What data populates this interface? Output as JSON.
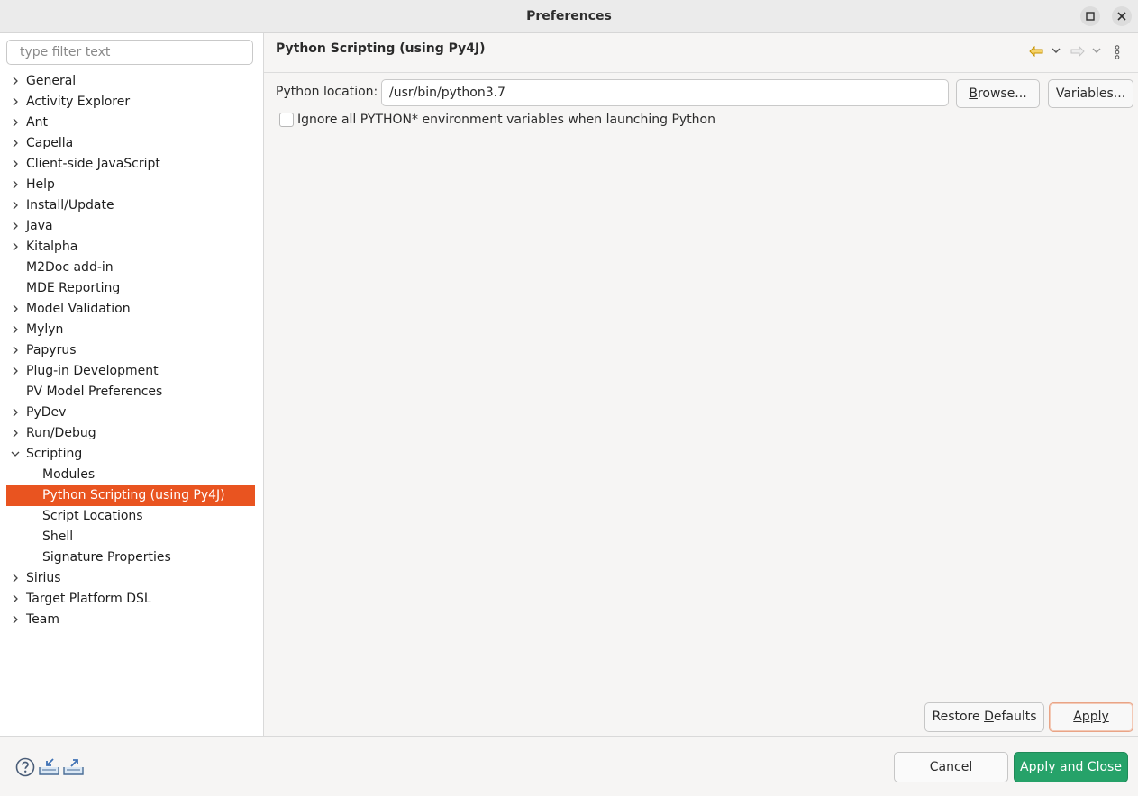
{
  "window": {
    "title": "Preferences"
  },
  "filter": {
    "placeholder": "type filter text"
  },
  "tree": {
    "items": [
      {
        "label": "General",
        "expandable": true
      },
      {
        "label": "Activity Explorer",
        "expandable": true
      },
      {
        "label": "Ant",
        "expandable": true
      },
      {
        "label": "Capella",
        "expandable": true
      },
      {
        "label": "Client-side JavaScript",
        "expandable": true
      },
      {
        "label": "Help",
        "expandable": true
      },
      {
        "label": "Install/Update",
        "expandable": true
      },
      {
        "label": "Java",
        "expandable": true
      },
      {
        "label": "Kitalpha",
        "expandable": true
      },
      {
        "label": "M2Doc add-in",
        "expandable": false
      },
      {
        "label": "MDE Reporting",
        "expandable": false
      },
      {
        "label": "Model Validation",
        "expandable": true
      },
      {
        "label": "Mylyn",
        "expandable": true
      },
      {
        "label": "Papyrus",
        "expandable": true
      },
      {
        "label": "Plug-in Development",
        "expandable": true
      },
      {
        "label": "PV Model Preferences",
        "expandable": false
      },
      {
        "label": "PyDev",
        "expandable": true
      },
      {
        "label": "Run/Debug",
        "expandable": true
      },
      {
        "label": "Scripting",
        "expandable": true,
        "expanded": true
      },
      {
        "label": "Modules",
        "child": true
      },
      {
        "label": "Python Scripting (using Py4J)",
        "child": true,
        "selected": true
      },
      {
        "label": "Script Locations",
        "child": true
      },
      {
        "label": "Shell",
        "child": true
      },
      {
        "label": "Signature Properties",
        "child": true
      },
      {
        "label": "Sirius",
        "expandable": true
      },
      {
        "label": "Target Platform DSL",
        "expandable": true
      },
      {
        "label": "Team",
        "expandable": true
      }
    ]
  },
  "page": {
    "title": "Python Scripting (using Py4J)",
    "location_label": "Python location:",
    "location_value": "/usr/bin/python3.7",
    "browse_label": "Browse...",
    "variables_label": "Variables...",
    "ignore_env_label": "Ignore all PYTHON* environment variables when launching Python",
    "ignore_env_checked": false,
    "restore_defaults_label": "Restore Defaults",
    "apply_label": "Apply"
  },
  "footer": {
    "cancel_label": "Cancel",
    "apply_close_label": "Apply and Close"
  },
  "colors": {
    "selection": "#e95420",
    "primary_button": "#26a269",
    "nav_back_arrow": "#e0a800"
  },
  "icons": {
    "nav_back": "back-arrow-icon",
    "nav_forward": "forward-arrow-icon",
    "menu": "vertical-dots-icon",
    "help": "help-icon",
    "import": "import-icon",
    "export": "export-icon"
  }
}
